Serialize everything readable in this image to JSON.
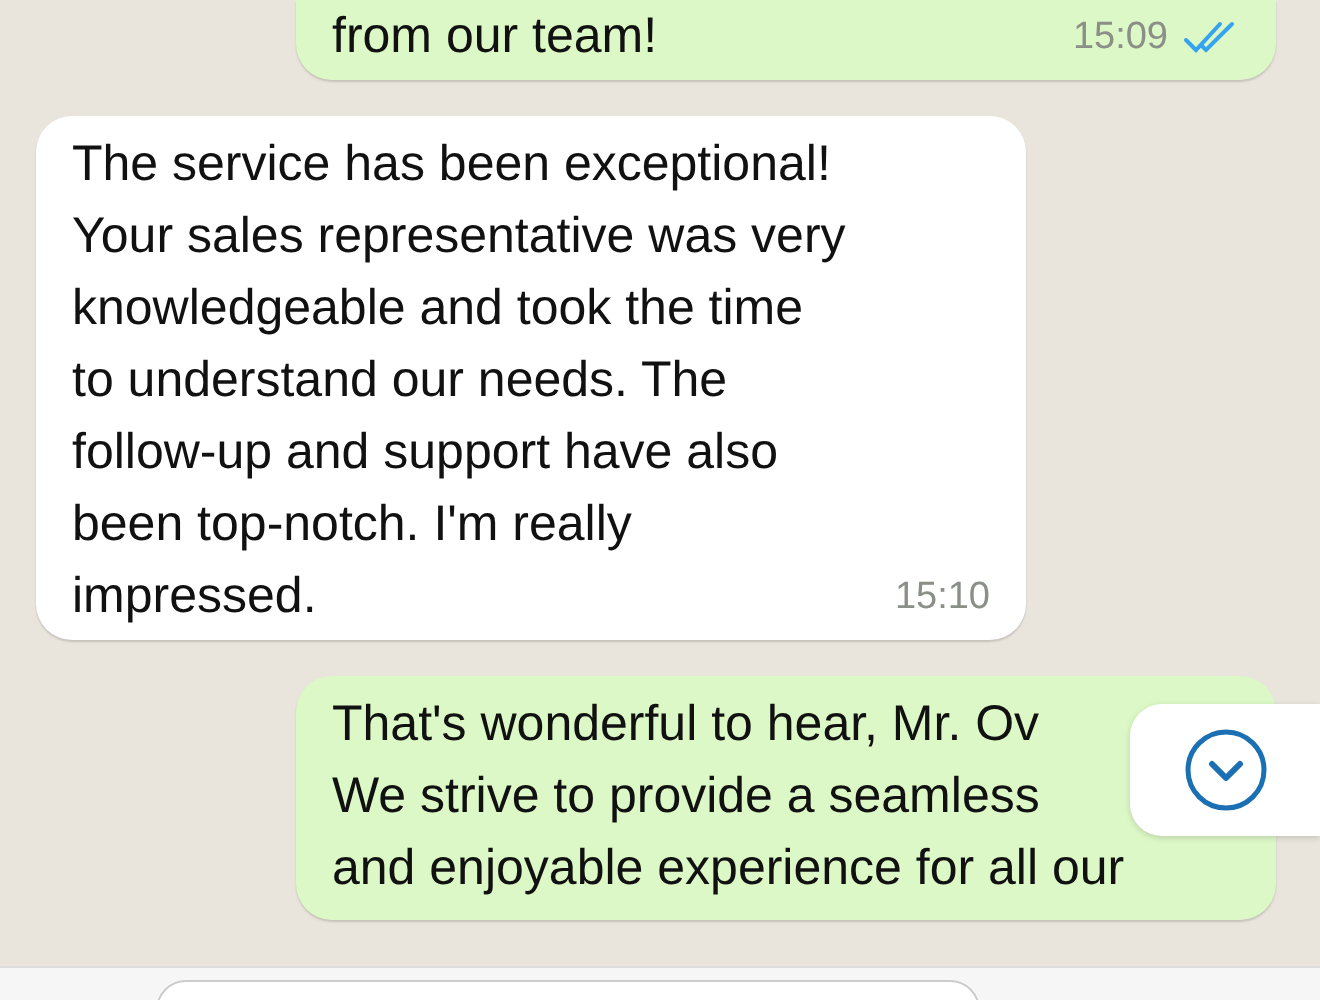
{
  "messages": [
    {
      "kind": "sent",
      "text": "from our team!",
      "time": "15:09",
      "read": true
    },
    {
      "kind": "received",
      "text": "The service has been exceptional!\nYour sales representative was very\nknowledgeable and took the time\nto understand our needs. The\nfollow-up and support have also\nbeen top-notch. I'm really\nimpressed.",
      "time": "15:10"
    },
    {
      "kind": "sent",
      "text": "That's wonderful to hear, Mr. Ov\nWe strive to provide a seamless\nand enjoyable experience for all our"
    }
  ]
}
